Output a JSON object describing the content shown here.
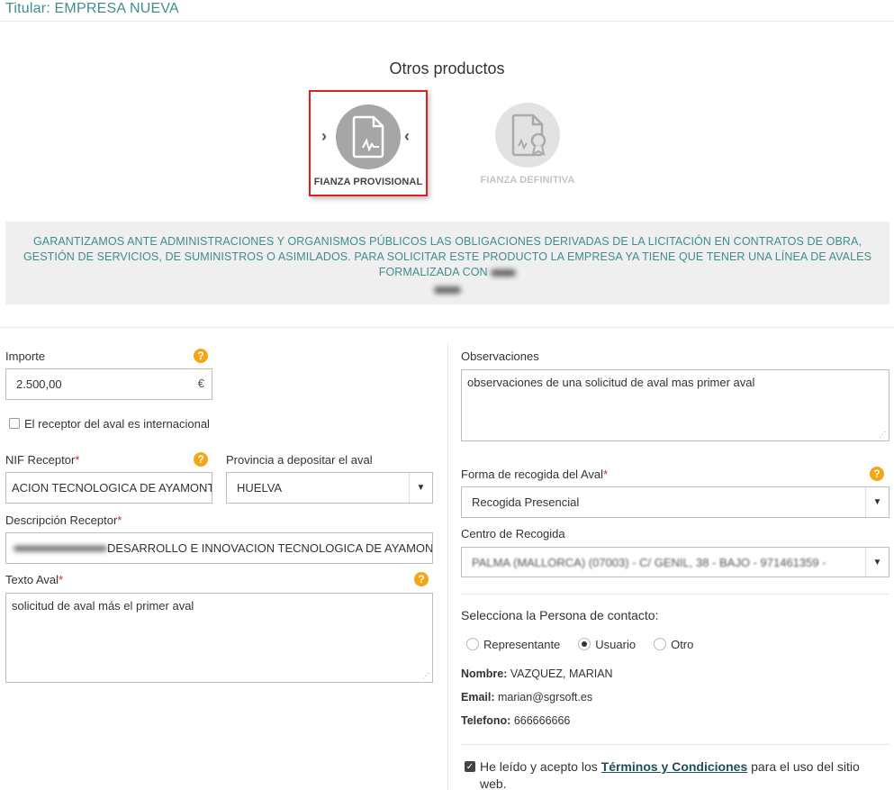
{
  "header": {
    "titular": "Titular: EMPRESA NUEVA"
  },
  "products": {
    "heading": "Otros productos",
    "items": [
      {
        "label": "FIANZA PROVISIONAL",
        "selected": true
      },
      {
        "label": "FIANZA DEFINITIVA",
        "selected": false
      }
    ]
  },
  "banner": {
    "text": "GARANTIZAMOS ANTE ADMINISTRACIONES Y ORGANISMOS PÚBLICOS LAS OBLIGACIONES DERIVADAS DE LA LICITACIÓN EN CONTRATOS DE OBRA, GESTIÓN DE SERVICIOS, DE SUMINISTROS O ASIMILADOS. PARA SOLICITAR ESTE PRODUCTO LA EMPRESA YA TIENE QUE TENER UNA LÍNEA DE AVALES FORMALIZADA CON"
  },
  "form": {
    "importe": {
      "label": "Importe",
      "value": "2.500,00",
      "suffix": "€"
    },
    "internacional": {
      "label": "El receptor del aval es internacional",
      "checked": false
    },
    "nif": {
      "label": "NIF Receptor",
      "value": "ACION TECNOLOGICA DE AYAMONTE"
    },
    "provincia": {
      "label": "Provincia a depositar el aval",
      "value": "HUELVA"
    },
    "descripcion": {
      "label": "Descripción Receptor",
      "value": "        DESARROLLO E INNOVACION TECNOLOGICA DE AYAMONTE"
    },
    "texto_aval": {
      "label": "Texto Aval",
      "value": "solicitud de aval más el primer aval"
    },
    "observaciones": {
      "label": "Observaciones",
      "value": "observaciones de una solicitud de aval mas primer aval"
    },
    "forma_recogida": {
      "label": "Forma de recogida del Aval",
      "value": "Recogida Presencial"
    },
    "centro_recogida": {
      "label": "Centro de Recogida",
      "value": "PALMA (MALLORCA) (07003) - C/ GENIL, 38 - BAJO - 971461359 -"
    },
    "contacto": {
      "label": "Selecciona la Persona de contacto:",
      "options": [
        "Representante",
        "Usuario",
        "Otro"
      ],
      "selected": "Usuario"
    },
    "persona": {
      "nombre_label": "Nombre:",
      "nombre": "VAZQUEZ, MARIAN",
      "email_label": "Email:",
      "email": "marian@sgrsoft.es",
      "telefono_label": "Telefono:",
      "telefono": "666666666"
    },
    "terms": {
      "prefix": "He leído y acepto los",
      "link": "Términos y Condiciones",
      "suffix": "para el uso del sitio web.",
      "checked": true
    }
  },
  "colors": {
    "accent": "#3e8e8c",
    "help": "#f3a712",
    "required": "#e02020",
    "highlight": "#e0201e"
  }
}
